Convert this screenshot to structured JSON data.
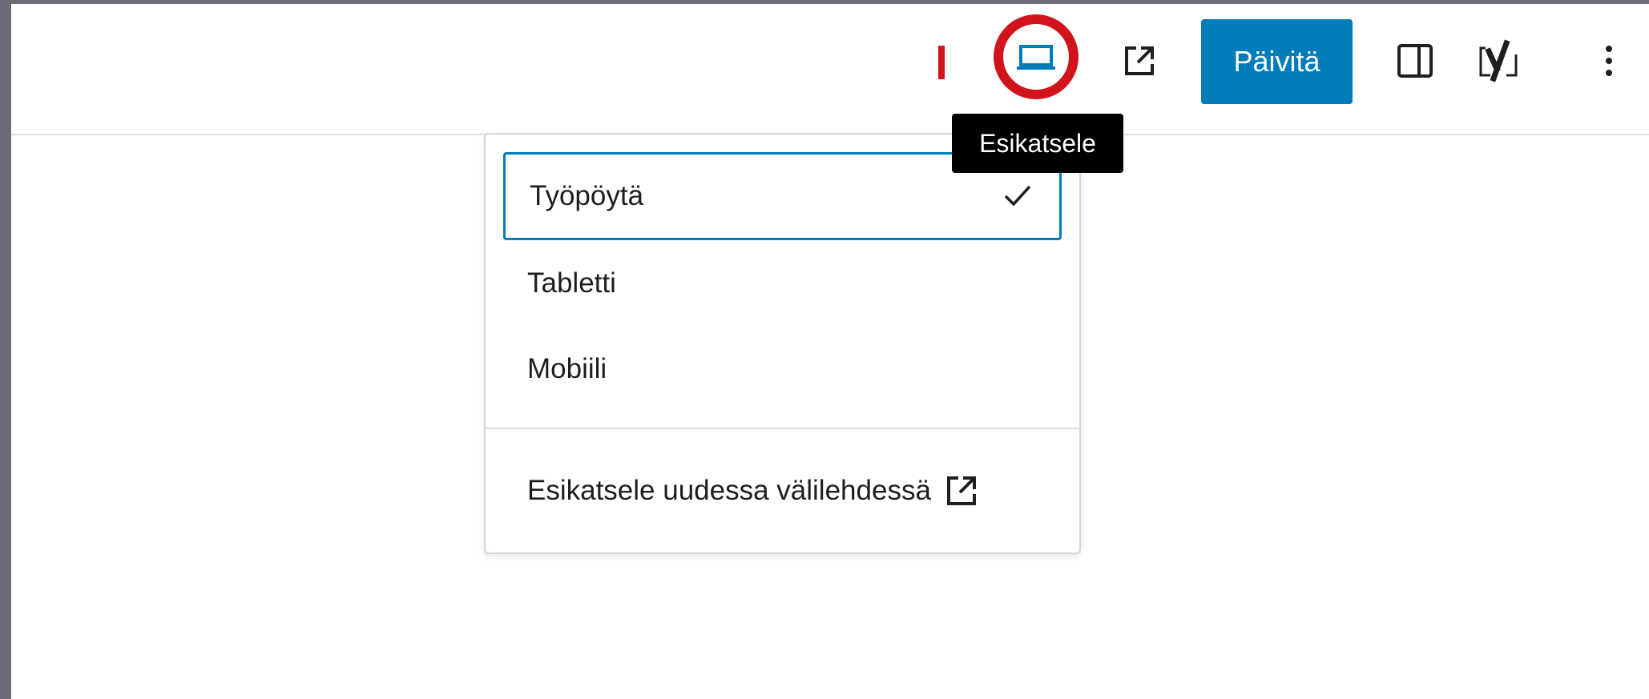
{
  "toolbar": {
    "preview_icon": "laptop-icon",
    "external_icon": "external-link-icon",
    "update_label": "Päivitä",
    "sidebar_icon": "sidebar-toggle-icon",
    "yoast_icon": "yoast-seo-icon",
    "options_icon": "more-vertical-icon",
    "accent_color": "#007cba",
    "highlight_color": "#d1141b"
  },
  "tooltip": {
    "text": "Esikatsele"
  },
  "preview_menu": {
    "items": [
      {
        "label": "Työpöytä",
        "selected": true
      },
      {
        "label": "Tabletti",
        "selected": false
      },
      {
        "label": "Mobiili",
        "selected": false
      }
    ],
    "new_tab_label": "Esikatsele uudessa välilehdessä"
  }
}
